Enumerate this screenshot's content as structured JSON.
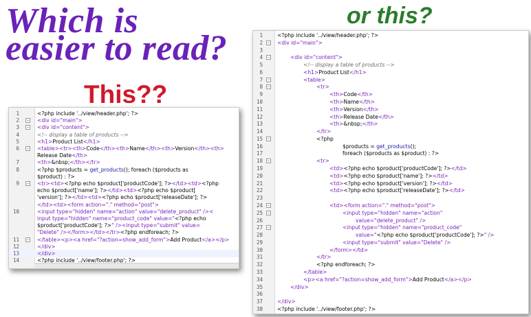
{
  "headings": {
    "which": "Which is",
    "easier": "easier to read?",
    "this": "This??",
    "or_this": "or this?"
  },
  "left_editor": {
    "lines": [
      {
        "num": "1",
        "fold": "",
        "segs": [
          {
            "t": "",
            "v": "<?php include '../view/header.php'; ?>"
          }
        ]
      },
      {
        "num": "2",
        "fold": "−",
        "segs": [
          {
            "t": "t",
            "v": "<div id=\"main\">"
          }
        ]
      },
      {
        "num": "3",
        "fold": "−",
        "segs": [
          {
            "t": "t",
            "v": "<div id=\"content\">"
          }
        ]
      },
      {
        "num": "4",
        "fold": "",
        "segs": [
          {
            "t": "c",
            "v": "<!-- display a table of products -->"
          }
        ]
      },
      {
        "num": "5",
        "fold": "",
        "segs": [
          {
            "t": "t",
            "v": "<h1>"
          },
          {
            "t": "",
            "v": "Product List"
          },
          {
            "t": "t",
            "v": "</h1>"
          }
        ]
      },
      {
        "num": "6",
        "fold": "−",
        "segs": [
          {
            "t": "t",
            "v": "<table><tr><th>"
          },
          {
            "t": "",
            "v": "Code"
          },
          {
            "t": "t",
            "v": "</th><th>"
          },
          {
            "t": "",
            "v": "Name"
          },
          {
            "t": "t",
            "v": "</th><th>"
          },
          {
            "t": "",
            "v": "Version"
          },
          {
            "t": "t",
            "v": "</th><th>"
          }
        ]
      },
      {
        "num": "",
        "fold": "",
        "segs": [
          {
            "t": "",
            "v": "Release Date"
          },
          {
            "t": "t",
            "v": "</th>"
          }
        ]
      },
      {
        "num": "7",
        "fold": "",
        "segs": [
          {
            "t": "t",
            "v": "<th>"
          },
          {
            "t": "",
            "v": "&nbsp;"
          },
          {
            "t": "t",
            "v": "</th></tr>"
          }
        ]
      },
      {
        "num": "8",
        "fold": "",
        "segs": [
          {
            "t": "",
            "v": "<?php $products = "
          },
          {
            "t": "s",
            "v": "get_products"
          },
          {
            "t": "",
            "v": "(); foreach ($products as"
          }
        ]
      },
      {
        "num": "",
        "fold": "",
        "segs": [
          {
            "t": "",
            "v": "$product) : ?>"
          }
        ]
      },
      {
        "num": "9",
        "fold": "−",
        "segs": [
          {
            "t": "t",
            "v": "<tr><td>"
          },
          {
            "t": "",
            "v": "<?php echo $product['productCode']; ?>"
          },
          {
            "t": "t",
            "v": "</td><td>"
          },
          {
            "t": "",
            "v": "<?php"
          }
        ]
      },
      {
        "num": "",
        "fold": "",
        "segs": [
          {
            "t": "",
            "v": "echo $product['name']; ?>"
          },
          {
            "t": "t",
            "v": "</td><td>"
          },
          {
            "t": "",
            "v": "<?php echo $product["
          }
        ]
      },
      {
        "num": "",
        "fold": "",
        "segs": [
          {
            "t": "",
            "v": "'version']; ?>"
          },
          {
            "t": "t",
            "v": "</td><td>"
          },
          {
            "t": "",
            "v": "<?php echo $product['releaseDate']; ?>"
          }
        ]
      },
      {
        "num": "",
        "fold": "",
        "segs": [
          {
            "t": "t",
            "v": "</td><td><form action=\".\" method=\"post\">"
          }
        ]
      },
      {
        "num": "10",
        "fold": "",
        "segs": [
          {
            "t": "t",
            "v": "<input type=\"hidden\" name=\"action\" value=\"delete_product\" /><"
          }
        ]
      },
      {
        "num": "",
        "fold": "",
        "segs": [
          {
            "t": "t",
            "v": "input type=\"hidden\" name=\"product_code\" value=\""
          },
          {
            "t": "",
            "v": "<?php echo"
          }
        ]
      },
      {
        "num": "",
        "fold": "",
        "segs": [
          {
            "t": "",
            "v": "$product['productCode']; ?>"
          },
          {
            "t": "t",
            "v": "\" /><input type=\"submit\" value="
          }
        ]
      },
      {
        "num": "",
        "fold": "",
        "segs": [
          {
            "t": "t",
            "v": "\"Delete\" /></form></td></tr>"
          },
          {
            "t": "",
            "v": "<?php endforeach; ?>"
          }
        ]
      },
      {
        "num": "11",
        "fold": "−",
        "segs": [
          {
            "t": "t",
            "v": "</table><p><a href=\"?action=show_add_form\">"
          },
          {
            "t": "",
            "v": "Add Product"
          },
          {
            "t": "t",
            "v": "</a></p>"
          }
        ]
      },
      {
        "num": "12",
        "fold": "",
        "segs": [
          {
            "t": "t",
            "v": "</div>"
          }
        ]
      },
      {
        "num": "13",
        "fold": "",
        "segs": [
          {
            "t": "t",
            "v": "</div>"
          }
        ]
      },
      {
        "num": "14",
        "fold": "",
        "segs": [
          {
            "t": "",
            "v": "<?php include '../view/footer.php'; ?>"
          }
        ]
      }
    ]
  },
  "right_editor": {
    "lines": [
      {
        "num": "1",
        "fold": "",
        "indent": 0,
        "segs": [
          {
            "t": "",
            "v": "<?php include '../view/header.php'; ?>"
          }
        ]
      },
      {
        "num": "2",
        "fold": "−",
        "indent": 0,
        "segs": [
          {
            "t": "t",
            "v": "<div id=\"main\">"
          }
        ]
      },
      {
        "num": "3",
        "fold": "",
        "indent": 0,
        "segs": []
      },
      {
        "num": "4",
        "fold": "−",
        "indent": 1,
        "segs": [
          {
            "t": "t",
            "v": "<div id=\"content\">"
          }
        ]
      },
      {
        "num": "5",
        "fold": "",
        "indent": 2,
        "segs": [
          {
            "t": "c",
            "v": "<!-- display a table of products -->"
          }
        ]
      },
      {
        "num": "6",
        "fold": "",
        "indent": 2,
        "segs": [
          {
            "t": "t",
            "v": "<h1>"
          },
          {
            "t": "",
            "v": "Product List"
          },
          {
            "t": "t",
            "v": "</h1>"
          }
        ]
      },
      {
        "num": "7",
        "fold": "−",
        "indent": 2,
        "segs": [
          {
            "t": "t",
            "v": "<table>"
          }
        ]
      },
      {
        "num": "8",
        "fold": "−",
        "indent": 3,
        "segs": [
          {
            "t": "t",
            "v": "<tr>"
          }
        ]
      },
      {
        "num": "9",
        "fold": "",
        "indent": 4,
        "segs": [
          {
            "t": "t",
            "v": "<th>"
          },
          {
            "t": "",
            "v": "Code"
          },
          {
            "t": "t",
            "v": "</th>"
          }
        ]
      },
      {
        "num": "10",
        "fold": "",
        "indent": 4,
        "segs": [
          {
            "t": "t",
            "v": "<th>"
          },
          {
            "t": "",
            "v": "Name"
          },
          {
            "t": "t",
            "v": "</th>"
          }
        ]
      },
      {
        "num": "11",
        "fold": "",
        "indent": 4,
        "segs": [
          {
            "t": "t",
            "v": "<th>"
          },
          {
            "t": "",
            "v": "Version"
          },
          {
            "t": "t",
            "v": "</th>"
          }
        ]
      },
      {
        "num": "12",
        "fold": "",
        "indent": 4,
        "segs": [
          {
            "t": "t",
            "v": "<th>"
          },
          {
            "t": "",
            "v": "Release Date"
          },
          {
            "t": "t",
            "v": "</th>"
          }
        ]
      },
      {
        "num": "13",
        "fold": "",
        "indent": 4,
        "segs": [
          {
            "t": "t",
            "v": "<th>"
          },
          {
            "t": "",
            "v": "&nbsp;"
          },
          {
            "t": "t",
            "v": "</th>"
          }
        ]
      },
      {
        "num": "14",
        "fold": "",
        "indent": 3,
        "segs": [
          {
            "t": "t",
            "v": "</tr>"
          }
        ]
      },
      {
        "num": "15",
        "fold": "−",
        "indent": 3,
        "segs": [
          {
            "t": "",
            "v": "<?php"
          }
        ]
      },
      {
        "num": "16",
        "fold": "",
        "indent": 5,
        "segs": [
          {
            "t": "",
            "v": "$products = "
          },
          {
            "t": "s",
            "v": "get_products"
          },
          {
            "t": "",
            "v": "();"
          }
        ]
      },
      {
        "num": "17",
        "fold": "",
        "indent": 5,
        "segs": [
          {
            "t": "",
            "v": "foreach ($products as $product) : ?>"
          }
        ]
      },
      {
        "num": "18",
        "fold": "−",
        "indent": 3,
        "segs": [
          {
            "t": "t",
            "v": "<tr>"
          }
        ]
      },
      {
        "num": "19",
        "fold": "",
        "indent": 4,
        "segs": [
          {
            "t": "t",
            "v": "<td>"
          },
          {
            "t": "",
            "v": "<?php echo $product['productCode']; ?>"
          },
          {
            "t": "t",
            "v": "</td>"
          }
        ]
      },
      {
        "num": "20",
        "fold": "",
        "indent": 4,
        "segs": [
          {
            "t": "t",
            "v": "<td>"
          },
          {
            "t": "",
            "v": "<?php echo $product['name']; ?>"
          },
          {
            "t": "t",
            "v": "</td>"
          }
        ]
      },
      {
        "num": "21",
        "fold": "",
        "indent": 4,
        "segs": [
          {
            "t": "t",
            "v": "<td>"
          },
          {
            "t": "",
            "v": "<?php echo $product['version']; ?>"
          },
          {
            "t": "t",
            "v": "</td>"
          }
        ]
      },
      {
        "num": "22",
        "fold": "",
        "indent": 4,
        "segs": [
          {
            "t": "t",
            "v": "<td>"
          },
          {
            "t": "",
            "v": "<?php echo $product['releaseDate']; ?>"
          },
          {
            "t": "t",
            "v": "</td>"
          }
        ]
      },
      {
        "num": "23",
        "fold": "",
        "indent": 0,
        "segs": []
      },
      {
        "num": "24",
        "fold": "−",
        "indent": 4,
        "segs": [
          {
            "t": "t",
            "v": "<td><form action=\".\" method=\"post\">"
          }
        ]
      },
      {
        "num": "25",
        "fold": "−",
        "indent": 5,
        "segs": [
          {
            "t": "t",
            "v": "<input type=\"hidden\" name=\"action\""
          }
        ]
      },
      {
        "num": "26",
        "fold": "",
        "indent": 6,
        "segs": [
          {
            "t": "t",
            "v": "value=\"delete_product\" />"
          }
        ]
      },
      {
        "num": "27",
        "fold": "−",
        "indent": 5,
        "segs": [
          {
            "t": "t",
            "v": "<input type=\"hidden\" name=\"product_code\""
          }
        ]
      },
      {
        "num": "28",
        "fold": "",
        "indent": 6,
        "segs": [
          {
            "t": "t",
            "v": "value=\""
          },
          {
            "t": "",
            "v": "<?php echo $product['productCode']; ?>"
          },
          {
            "t": "t",
            "v": "\" />"
          }
        ]
      },
      {
        "num": "29",
        "fold": "",
        "indent": 5,
        "segs": [
          {
            "t": "t",
            "v": "<input type=\"submit\" value=\"Delete\" />"
          }
        ]
      },
      {
        "num": "30",
        "fold": "",
        "indent": 4,
        "segs": [
          {
            "t": "t",
            "v": "</form></td>"
          }
        ]
      },
      {
        "num": "31",
        "fold": "",
        "indent": 3,
        "segs": [
          {
            "t": "t",
            "v": "</tr>"
          }
        ]
      },
      {
        "num": "32",
        "fold": "",
        "indent": 3,
        "segs": [
          {
            "t": "",
            "v": "<?php endforeach; ?>"
          }
        ]
      },
      {
        "num": "33",
        "fold": "",
        "indent": 2,
        "segs": [
          {
            "t": "t",
            "v": "</table>"
          }
        ]
      },
      {
        "num": "34",
        "fold": "",
        "indent": 2,
        "segs": [
          {
            "t": "t",
            "v": "<p><a href=\"?action=show_add_form\">"
          },
          {
            "t": "",
            "v": "Add Product"
          },
          {
            "t": "t",
            "v": "</a></p>"
          }
        ]
      },
      {
        "num": "35",
        "fold": "",
        "indent": 1,
        "segs": [
          {
            "t": "t",
            "v": "</div>"
          }
        ]
      },
      {
        "num": "36",
        "fold": "",
        "indent": 0,
        "segs": []
      },
      {
        "num": "37",
        "fold": "",
        "indent": 0,
        "segs": [
          {
            "t": "t",
            "v": "</div>"
          }
        ]
      },
      {
        "num": "38",
        "fold": "",
        "indent": 0,
        "segs": [
          {
            "t": "",
            "v": "<?php include '../view/footer.php'; ?>"
          }
        ]
      }
    ]
  }
}
